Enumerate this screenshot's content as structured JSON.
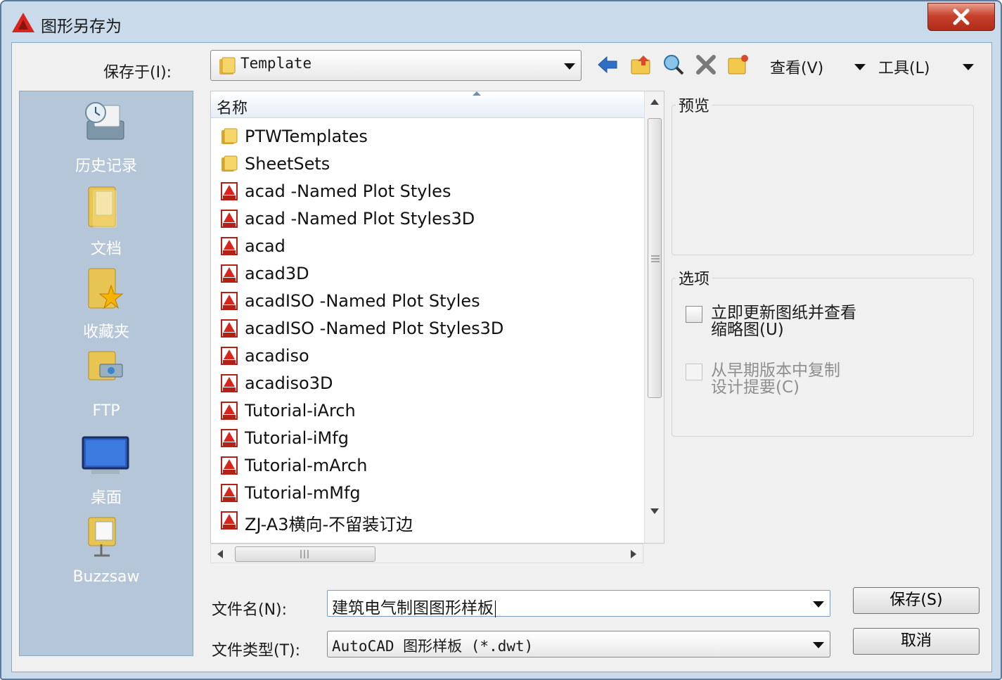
{
  "window": {
    "title": "图形另存为"
  },
  "toolbar": {
    "save_in_label": "保存于(I):",
    "location": "Template",
    "view_menu": "查看(V)",
    "tools_menu": "工具(L)",
    "icons": [
      "back-arrow-icon",
      "up-folder-icon",
      "search-web-icon",
      "delete-icon",
      "new-folder-icon"
    ]
  },
  "places": [
    {
      "label": "历史记录",
      "icon": "history-icon"
    },
    {
      "label": "文档",
      "icon": "documents-folder-icon"
    },
    {
      "label": "收藏夹",
      "icon": "favorites-folder-icon"
    },
    {
      "label": "FTP",
      "icon": "ftp-folder-icon"
    },
    {
      "label": "桌面",
      "icon": "desktop-icon"
    },
    {
      "label": "Buzzsaw",
      "icon": "buzzsaw-folder-icon"
    }
  ],
  "file_list": {
    "header": "名称",
    "items": [
      {
        "name": "PTWTemplates",
        "type": "folder"
      },
      {
        "name": "SheetSets",
        "type": "folder"
      },
      {
        "name": "acad -Named Plot Styles",
        "type": "dwt"
      },
      {
        "name": "acad -Named Plot Styles3D",
        "type": "dwt"
      },
      {
        "name": "acad",
        "type": "dwt"
      },
      {
        "name": "acad3D",
        "type": "dwt"
      },
      {
        "name": "acadISO -Named Plot Styles",
        "type": "dwt"
      },
      {
        "name": "acadISO -Named Plot Styles3D",
        "type": "dwt"
      },
      {
        "name": "acadiso",
        "type": "dwt"
      },
      {
        "name": "acadiso3D",
        "type": "dwt"
      },
      {
        "name": "Tutorial-iArch",
        "type": "dwt"
      },
      {
        "name": "Tutorial-iMfg",
        "type": "dwt"
      },
      {
        "name": "Tutorial-mArch",
        "type": "dwt"
      },
      {
        "name": "Tutorial-mMfg",
        "type": "dwt"
      },
      {
        "name": "ZJ-A3横向-不留装订边",
        "type": "dwt"
      }
    ]
  },
  "preview": {
    "title": "预览"
  },
  "options": {
    "title": "选项",
    "update_sheet": {
      "line1": "立即更新图纸并查看",
      "line2": "缩略图(U)",
      "checked": false
    },
    "copy_design": {
      "line1": "从早期版本中复制",
      "line2": "设计提要(C)",
      "checked": false
    }
  },
  "filename": {
    "label": "文件名(N):",
    "value": "建筑电气制图图形样板"
  },
  "filetype": {
    "label": "文件类型(T):",
    "value": "AutoCAD 图形样板 (*.dwt)"
  },
  "buttons": {
    "save": "保存(S)",
    "cancel": "取消"
  },
  "colors": {
    "places_bg": "#b4c6d8",
    "window_frame": "#c9daea",
    "close_button": "#c8432e"
  }
}
